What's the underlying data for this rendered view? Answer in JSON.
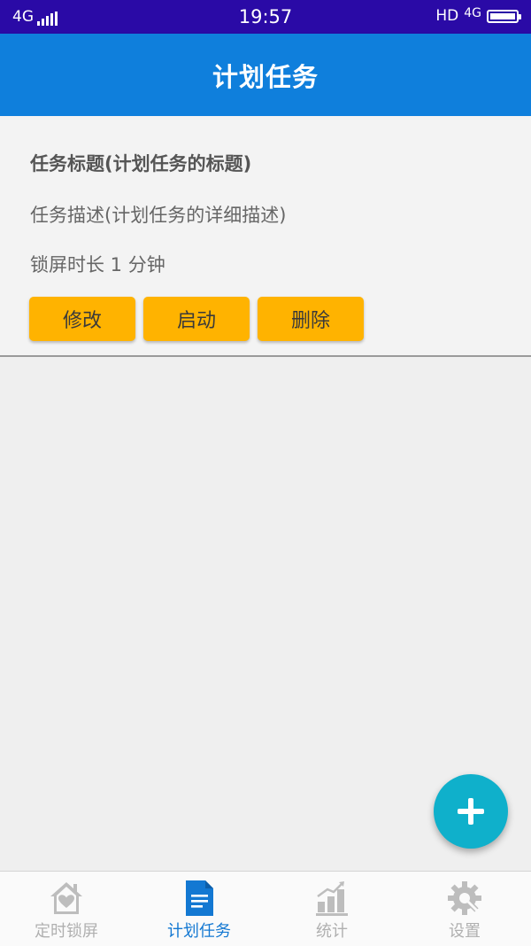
{
  "status_bar": {
    "network_left": "4G",
    "time": "19:57",
    "hd": "HD",
    "network_right": "4G"
  },
  "app_bar": {
    "title": "计划任务"
  },
  "task": {
    "title": "任务标题(计划任务的标题)",
    "description": "任务描述(计划任务的详细描述)",
    "duration": "锁屏时长 1 分钟",
    "buttons": {
      "edit": "修改",
      "start": "启动",
      "delete": "删除"
    }
  },
  "bottom_nav": {
    "items": [
      {
        "label": "定时锁屏",
        "icon": "home-icon",
        "active": false
      },
      {
        "label": "计划任务",
        "icon": "document-icon",
        "active": true
      },
      {
        "label": "统计",
        "icon": "bar-chart-icon",
        "active": false
      },
      {
        "label": "设置",
        "icon": "settings-gear-icon",
        "active": false
      }
    ]
  },
  "colors": {
    "status_bar": "#2a0aa6",
    "app_bar": "#0f7fdc",
    "button": "#ffb300",
    "fab": "#0fb0cb",
    "nav_active": "#1378d2",
    "nav_inactive": "#b0b0b0"
  }
}
